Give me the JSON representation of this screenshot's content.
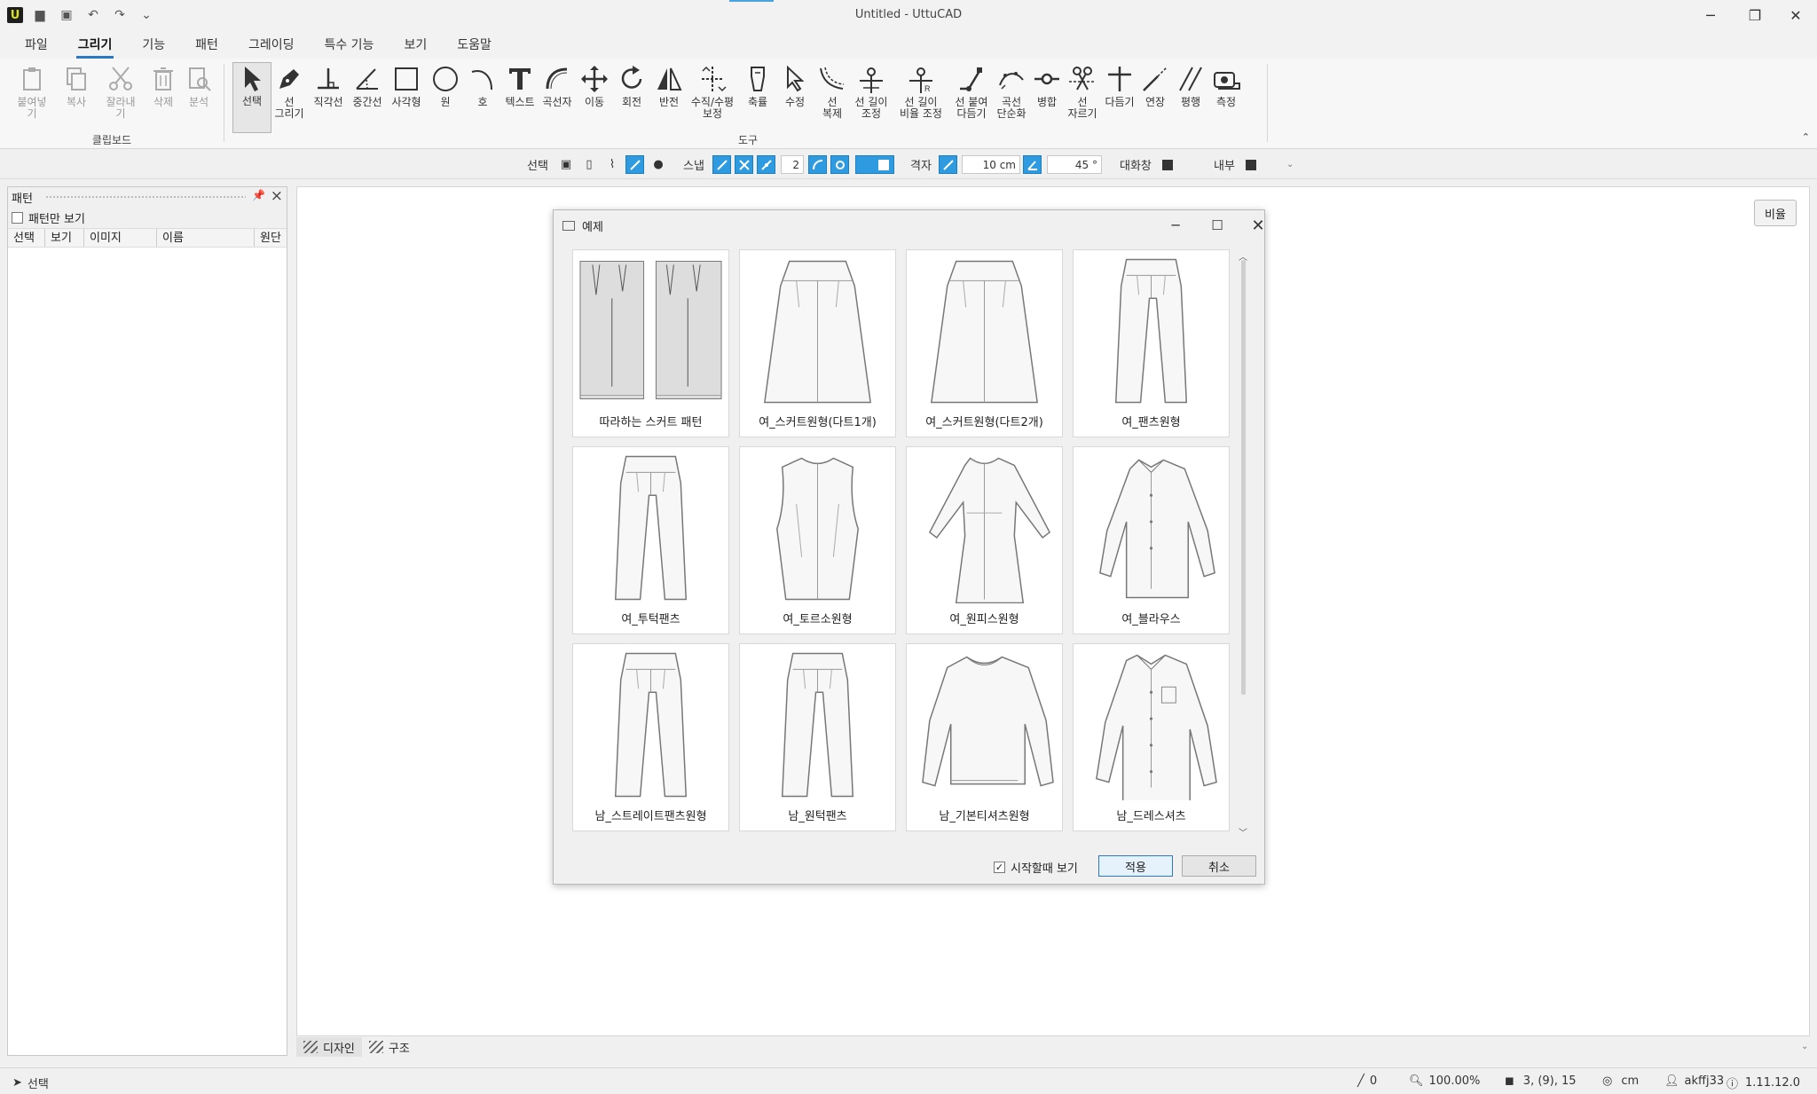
{
  "window": {
    "title": "Untitled - UttuCAD",
    "logo_letter": "U"
  },
  "menu": [
    "파일",
    "그리기",
    "기능",
    "패턴",
    "그레이딩",
    "특수 기능",
    "보기",
    "도움말"
  ],
  "ribbon": {
    "clipboard": {
      "label": "클립보드",
      "items": [
        "붙여넣기",
        "복사",
        "잘라내기",
        "삭제",
        "분석"
      ]
    },
    "tools": {
      "label": "도구",
      "items": [
        "선택",
        "선\n그리기",
        "직각선",
        "중간선",
        "사각형",
        "원",
        "호",
        "텍스트",
        "곡선자",
        "이동",
        "회전",
        "반전",
        "수직/수평\n보정",
        "축률",
        "수정",
        "선\n복제",
        "선 길이\n조정",
        "선 길이\n비율 조정",
        "선 붙여\n다듬기",
        "곡선\n단순화",
        "병합",
        "선\n자르기",
        "다듬기",
        "연장",
        "평행",
        "측정"
      ]
    }
  },
  "toolbar2": {
    "select_label": "선택",
    "snap_label": "스냅",
    "snap_value": "2",
    "grid_label": "격자",
    "grid_size": "10 cm",
    "angle": "45 °",
    "dialog_label": "대화창",
    "inner_label": "내부"
  },
  "left_panel": {
    "title": "패턴",
    "filter_label": "패턴만 보기",
    "columns": [
      "선택",
      "보기",
      "이미지",
      "이름",
      "원단"
    ]
  },
  "canvas": {
    "ratio_button": "비율"
  },
  "bottom_tabs": [
    "디자인",
    "구조"
  ],
  "status": {
    "mode": "선택",
    "line_count": "0",
    "zoom": "100.00%",
    "layers": "3, (9), 15",
    "unit": "cm",
    "user": "akffj33",
    "version": "1.11.12.0"
  },
  "dialog": {
    "title": "예제",
    "items": [
      {
        "name": "따라하는 스커트 패턴",
        "icon": "skirt-pattern"
      },
      {
        "name": "여_스커트원형(다트1개)",
        "icon": "skirt"
      },
      {
        "name": "여_스커트원형(다트2개)",
        "icon": "skirt"
      },
      {
        "name": "여_팬츠원형",
        "icon": "pants"
      },
      {
        "name": "여_투턱팬츠",
        "icon": "pants"
      },
      {
        "name": "여_토르소원형",
        "icon": "torso"
      },
      {
        "name": "여_원피스원형",
        "icon": "dress"
      },
      {
        "name": "여_블라우스",
        "icon": "blouse"
      },
      {
        "name": "남_스트레이트팬츠원형",
        "icon": "pants"
      },
      {
        "name": "남_원턱팬츠",
        "icon": "pants"
      },
      {
        "name": "남_기본티셔츠원형",
        "icon": "tshirt"
      },
      {
        "name": "남_드레스셔츠",
        "icon": "shirt"
      }
    ],
    "startup_checkbox": "시작할때 보기",
    "startup_checked": true,
    "apply_button": "적용",
    "cancel_button": "취소"
  }
}
